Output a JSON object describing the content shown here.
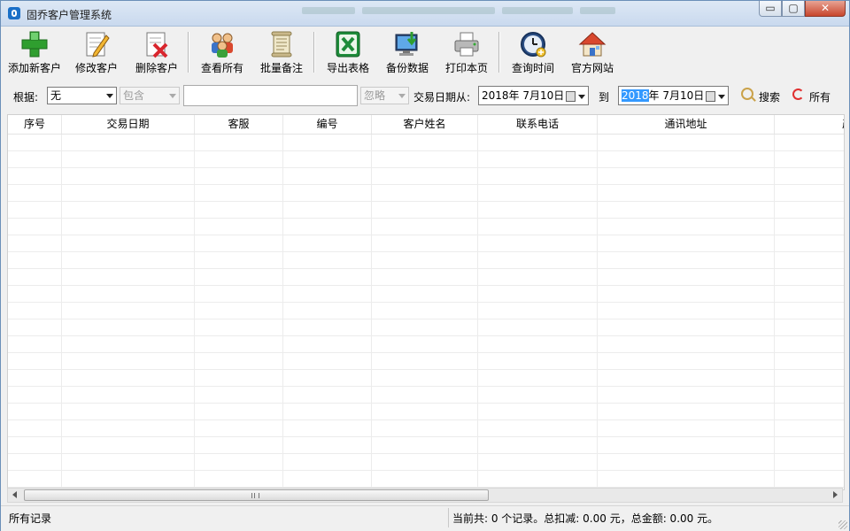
{
  "window": {
    "title": "固乔客户管理系统",
    "buttons": {
      "minimize": "▭",
      "maximize": "▢",
      "close": "✕"
    }
  },
  "toolbar": {
    "items": [
      {
        "label": "添加新客户",
        "icon": "add-customer-icon"
      },
      {
        "label": "修改客户",
        "icon": "edit-customer-icon"
      },
      {
        "label": "删除客户",
        "icon": "delete-customer-icon"
      },
      {
        "label": "查看所有",
        "icon": "view-all-icon"
      },
      {
        "label": "批量备注",
        "icon": "batch-note-icon"
      },
      {
        "label": "导出表格",
        "icon": "excel-export-icon"
      },
      {
        "label": "备份数据",
        "icon": "backup-icon"
      },
      {
        "label": "打印本页",
        "icon": "printer-icon"
      },
      {
        "label": "查询时间",
        "icon": "clock-icon"
      },
      {
        "label": "官方网站",
        "icon": "home-icon"
      }
    ],
    "colors": {
      "add": "#2f9e2f",
      "delete": "#d9262e",
      "excel": "#1e8c3a"
    }
  },
  "filter": {
    "basis_label": "根据:",
    "basis_value": "无",
    "match_value": "包含",
    "search_text": "",
    "ignore_value": "忽略",
    "date_from_label": "交易日期从:",
    "date_from": "2018年  7月10日",
    "to_label": "到",
    "date_to_selected": "2018",
    "date_to_rest": "年  7月10日",
    "search_label": "搜索",
    "all_label": "所有"
  },
  "table": {
    "columns": [
      "序号",
      "交易日期",
      "客服",
      "编号",
      "客户姓名",
      "联系电话",
      "通讯地址",
      "产"
    ]
  },
  "scrollbar": {
    "position": 0
  },
  "status": {
    "left": "所有记录",
    "summary": "当前共: 0 个记录。总扣减: 0.00 元，总金额: 0.00 元。"
  }
}
